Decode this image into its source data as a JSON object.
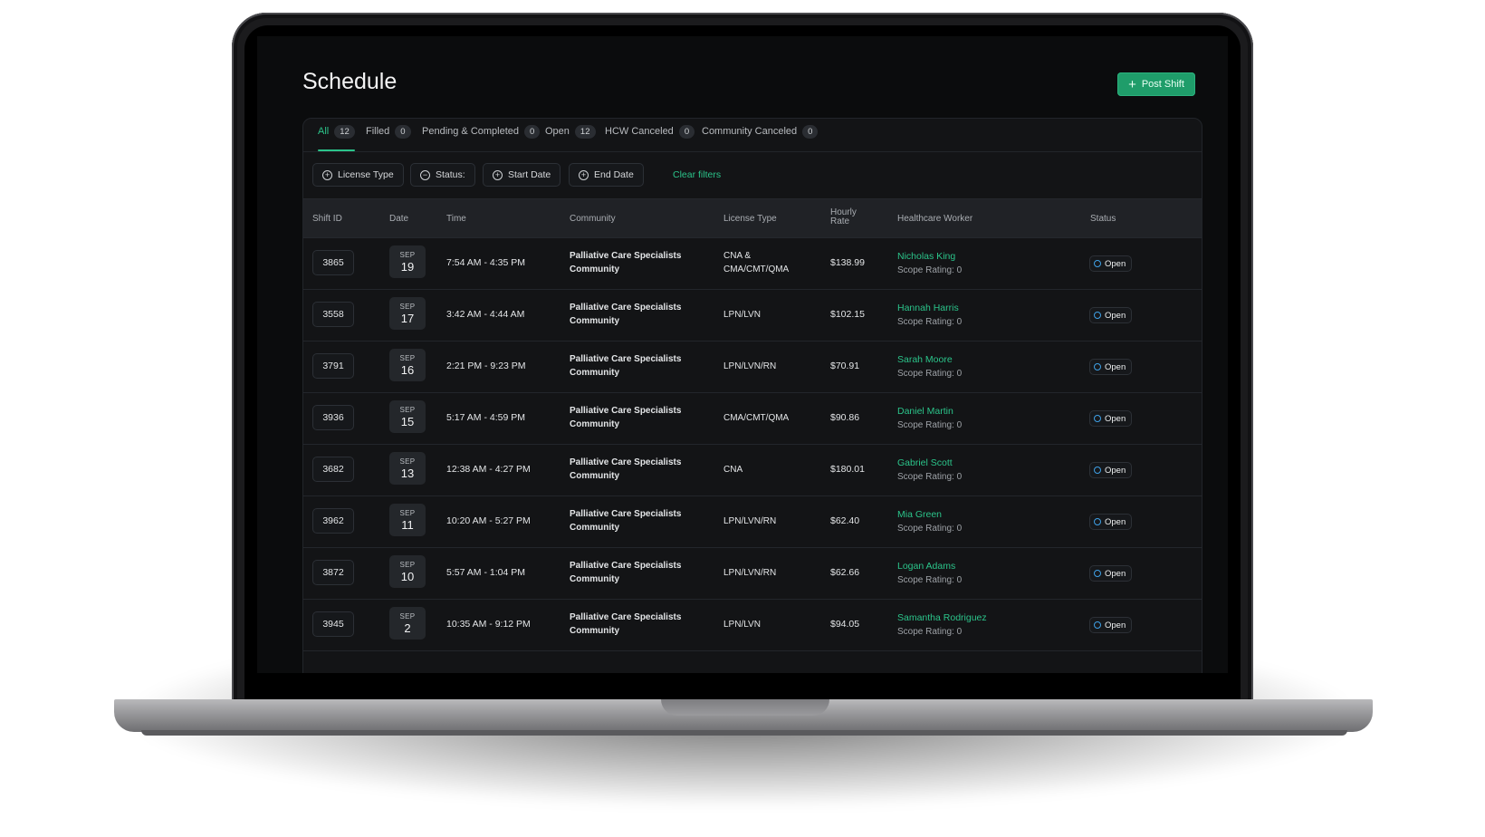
{
  "page": {
    "title": "Schedule",
    "post_button": "Post Shift"
  },
  "tabs": [
    {
      "label": "All",
      "count": "12"
    },
    {
      "label": "Filled",
      "count": "0"
    },
    {
      "label": "Pending & Completed",
      "count": "0"
    },
    {
      "label": "Open",
      "count": "12"
    },
    {
      "label": "HCW Canceled",
      "count": "0"
    },
    {
      "label": "Community Canceled",
      "count": "0"
    }
  ],
  "filters": {
    "license_type": "License Type",
    "status": "Status:",
    "start_date": "Start Date",
    "end_date": "End Date",
    "clear": "Clear filters"
  },
  "columns": {
    "shift_id": "Shift ID",
    "date": "Date",
    "time": "Time",
    "community": "Community",
    "license_type": "License Type",
    "hourly_rate_1": "Hourly",
    "hourly_rate_2": "Rate",
    "healthcare_worker": "Healthcare Worker",
    "status": "Status"
  },
  "rows": [
    {
      "id": "3865",
      "month": "SEP",
      "day": "19",
      "time": "7:54 AM - 4:35 PM",
      "community_1": "Palliative Care Specialists",
      "community_2": "Community",
      "license_1": "CNA &",
      "license_2": "CMA/CMT/QMA",
      "rate": "$138.99",
      "worker": "Nicholas King",
      "scope": "Scope Rating: 0",
      "status": "Open"
    },
    {
      "id": "3558",
      "month": "SEP",
      "day": "17",
      "time": "3:42 AM - 4:44 AM",
      "community_1": "Palliative Care Specialists",
      "community_2": "Community",
      "license_1": "LPN/LVN",
      "license_2": "",
      "rate": "$102.15",
      "worker": "Hannah Harris",
      "scope": "Scope Rating: 0",
      "status": "Open"
    },
    {
      "id": "3791",
      "month": "SEP",
      "day": "16",
      "time": "2:21 PM - 9:23 PM",
      "community_1": "Palliative Care Specialists",
      "community_2": "Community",
      "license_1": "LPN/LVN/RN",
      "license_2": "",
      "rate": "$70.91",
      "worker": "Sarah Moore",
      "scope": "Scope Rating: 0",
      "status": "Open"
    },
    {
      "id": "3936",
      "month": "SEP",
      "day": "15",
      "time": "5:17 AM - 4:59 PM",
      "community_1": "Palliative Care Specialists",
      "community_2": "Community",
      "license_1": "CMA/CMT/QMA",
      "license_2": "",
      "rate": "$90.86",
      "worker": "Daniel Martin",
      "scope": "Scope Rating: 0",
      "status": "Open"
    },
    {
      "id": "3682",
      "month": "SEP",
      "day": "13",
      "time": "12:38 AM - 4:27 PM",
      "community_1": "Palliative Care Specialists",
      "community_2": "Community",
      "license_1": "CNA",
      "license_2": "",
      "rate": "$180.01",
      "worker": "Gabriel Scott",
      "scope": "Scope Rating: 0",
      "status": "Open"
    },
    {
      "id": "3962",
      "month": "SEP",
      "day": "11",
      "time": "10:20 AM - 5:27 PM",
      "community_1": "Palliative Care Specialists",
      "community_2": "Community",
      "license_1": "LPN/LVN/RN",
      "license_2": "",
      "rate": "$62.40",
      "worker": "Mia Green",
      "scope": "Scope Rating: 0",
      "status": "Open"
    },
    {
      "id": "3872",
      "month": "SEP",
      "day": "10",
      "time": "5:57 AM - 1:04 PM",
      "community_1": "Palliative Care Specialists",
      "community_2": "Community",
      "license_1": "LPN/LVN/RN",
      "license_2": "",
      "rate": "$62.66",
      "worker": "Logan Adams",
      "scope": "Scope Rating: 0",
      "status": "Open"
    },
    {
      "id": "3945",
      "month": "SEP",
      "day": "2",
      "time": "10:35 AM - 9:12 PM",
      "community_1": "Palliative Care Specialists",
      "community_2": "Community",
      "license_1": "LPN/LVN",
      "license_2": "",
      "rate": "$94.05",
      "worker": "Samantha Rodriguez",
      "scope": "Scope Rating: 0",
      "status": "Open"
    }
  ]
}
